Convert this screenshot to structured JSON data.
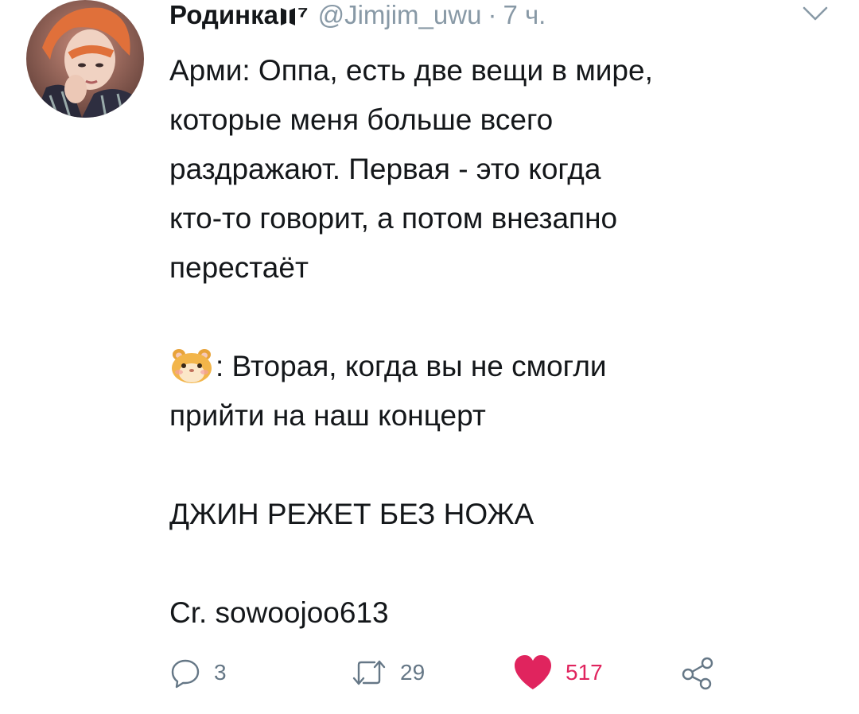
{
  "tweet": {
    "display_name": "Родинка",
    "display_name_suffix": "⁷",
    "handle": "@Jimjim_uwu",
    "separator": "·",
    "time": "7 ч.",
    "lines_p1": [
      "Арми: Оппа, есть две вещи в мире,",
      "которые меня больше всего",
      "раздражают. Первая - это когда",
      "кто-то говорит, а потом внезапно",
      "перестаёт"
    ],
    "lines_p2": [
      ": Вторая, когда вы не смогли",
      "прийти на наш концерт"
    ],
    "line_p3": "ДЖИН РЕЖЕТ БЕЗ НОЖА",
    "line_p4": "Cr. sowoojoo613",
    "emoji_icon": "hamster-face-emoji"
  },
  "actions": {
    "reply_count": "3",
    "retweet_count": "29",
    "like_count": "517"
  },
  "colors": {
    "text": "#14171a",
    "meta": "#8899a6",
    "action": "#657786",
    "like": "#e0245e"
  }
}
